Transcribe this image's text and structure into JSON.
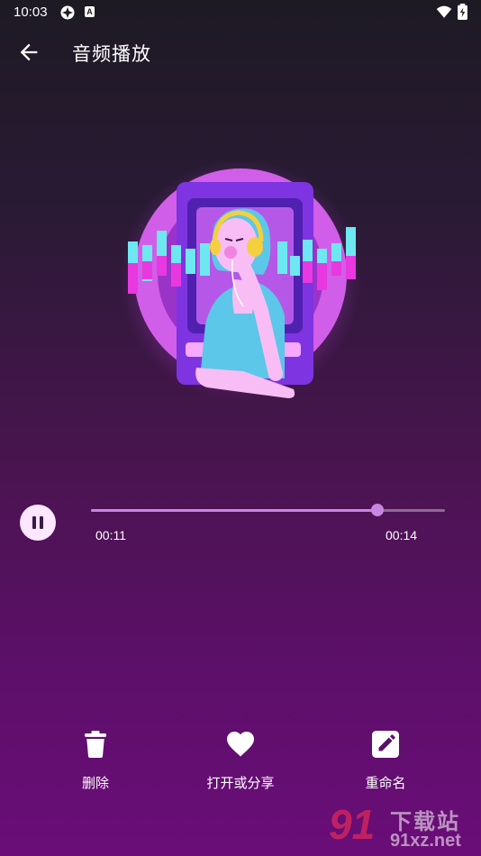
{
  "status_bar": {
    "time": "10:03",
    "icons": [
      "sync-icon",
      "font-a-icon",
      "wifi-icon",
      "battery-icon"
    ],
    "badge_letter": "A"
  },
  "app_bar": {
    "title": "音频播放",
    "back_icon": "back-arrow-icon"
  },
  "illustration": {
    "icon": "girl-with-headphones-illustration"
  },
  "player": {
    "state": "playing",
    "pause_icon": "pause-icon",
    "current_time": "00:11",
    "total_time": "00:14",
    "progress": 0.81
  },
  "actions": [
    {
      "label": "删除",
      "icon": "trash-icon"
    },
    {
      "label": "打开或分享",
      "icon": "heart-icon"
    },
    {
      "label": "重命名",
      "icon": "edit-icon"
    }
  ],
  "watermark": {
    "number": "91",
    "text": "下载站",
    "url": "91xz.net"
  },
  "colors": {
    "accent": "#c886e0",
    "track": "#8a6d93",
    "button_bg": "#fde6ff"
  }
}
